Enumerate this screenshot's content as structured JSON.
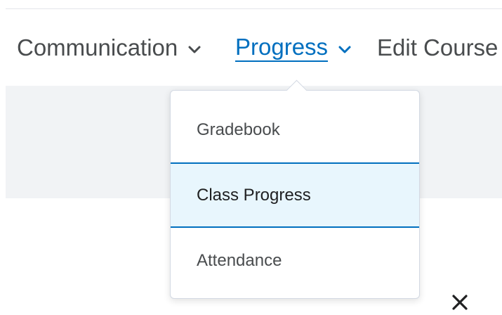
{
  "nav": {
    "communication": "Communication",
    "progress": "Progress",
    "edit_course": "Edit Course"
  },
  "dropdown": {
    "items": [
      {
        "label": "Gradebook"
      },
      {
        "label": "Class Progress",
        "state": "highlighted"
      },
      {
        "label": "Attendance"
      }
    ]
  },
  "icons": {
    "chevron": "chevron-down-icon",
    "close": "close-icon"
  },
  "colors": {
    "accent": "#006fbf",
    "text": "#494c4e",
    "highlight_bg": "#e8f6fd",
    "band_bg": "#f1f3f5"
  }
}
